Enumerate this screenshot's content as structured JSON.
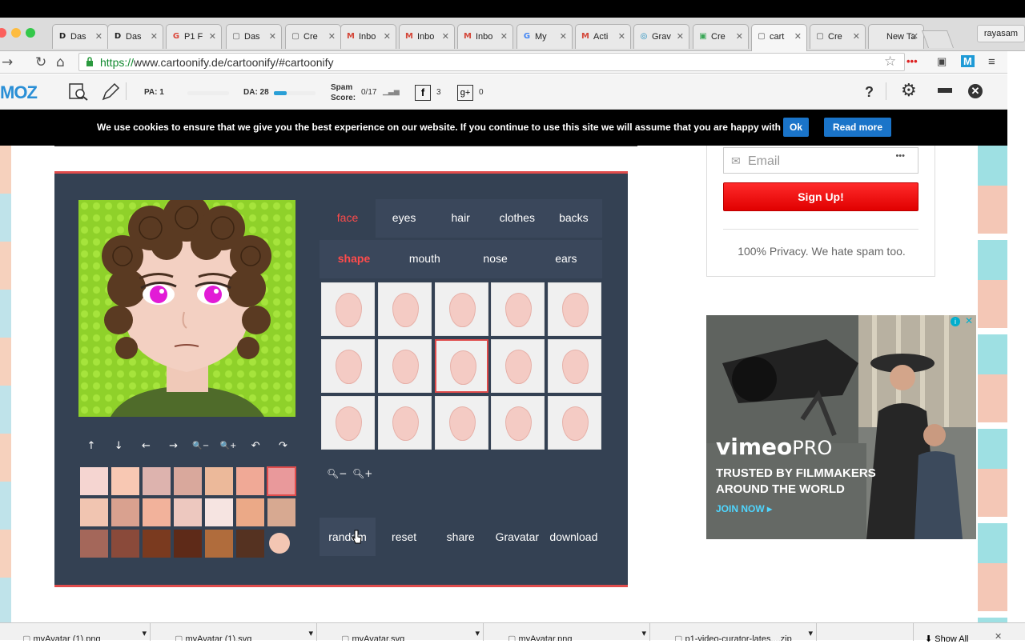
{
  "browser": {
    "tabs": [
      {
        "label": "Das",
        "fav": "D",
        "favcolor": "#222"
      },
      {
        "label": "Das",
        "fav": "D",
        "favcolor": "#222"
      },
      {
        "label": "P1 F",
        "fav": "G",
        "favcolor": "#db4437"
      },
      {
        "label": "Das",
        "fav": "▢",
        "favcolor": "#555"
      },
      {
        "label": "Cre",
        "fav": "▢",
        "favcolor": "#555"
      },
      {
        "label": "Inbo",
        "fav": "M",
        "favcolor": "#d44638"
      },
      {
        "label": "Inbo",
        "fav": "M",
        "favcolor": "#d44638"
      },
      {
        "label": "Inbo",
        "fav": "M",
        "favcolor": "#d44638"
      },
      {
        "label": "My",
        "fav": "G",
        "favcolor": "#4285f4"
      },
      {
        "label": "Acti",
        "fav": "M",
        "favcolor": "#d44638"
      },
      {
        "label": "Grav",
        "fav": "◎",
        "favcolor": "#1e8cbe"
      },
      {
        "label": "Cre",
        "fav": "▣",
        "favcolor": "#3aa757"
      },
      {
        "label": "cart",
        "fav": "▢",
        "favcolor": "#555"
      },
      {
        "label": "Cre",
        "fav": "▢",
        "favcolor": "#555"
      },
      {
        "label": "New Ta",
        "fav": "",
        "favcolor": "#555"
      }
    ],
    "profile": "rayasam",
    "url_scheme": "https://",
    "url_rest": "www.cartoonify.de/cartoonify/#cartoonify"
  },
  "moz": {
    "logo": "MOZ",
    "pa_label": "PA: 1",
    "da_label": "DA: 28",
    "da_fill": 0.3,
    "spam_label": "Spam",
    "spam_label2": "Score:",
    "spam_value": "0/17",
    "fb_count": "3",
    "gplus_count": "0",
    "help": "?"
  },
  "cookie": {
    "message": "We use cookies to ensure that we give you the best experience on our website. If you continue to use this site we will assume that you are happy with it.",
    "ok": "Ok",
    "read_more": "Read more"
  },
  "editor": {
    "main_tabs": [
      "face",
      "eyes",
      "hair",
      "clothes",
      "backs"
    ],
    "sub_tabs": [
      "shape",
      "mouth",
      "nose",
      "ears"
    ],
    "active_main": "face",
    "active_sub": "shape",
    "actions": [
      "random",
      "reset",
      "share",
      "Gravatar",
      "download"
    ],
    "controls": [
      "↑",
      "↓",
      "←",
      "→",
      "🔍−",
      "🔍+",
      "↶",
      "↷"
    ],
    "selected_shape": 8,
    "skin_colors": [
      [
        "#f5d5d1",
        "#f8c8b3",
        "#ddb3ae",
        "#d9a89c",
        "#ecb99a",
        "#f0a996",
        "#e9999b"
      ],
      [
        "#f1c5b1",
        "#d9a18f",
        "#f2b29b",
        "#edc8bf",
        "#f6e4e1",
        "#eba987",
        "#d7a991"
      ],
      [
        "#a4675a",
        "#8a4a3a",
        "#7a3a1f",
        "#5e2a18",
        "#b06c3c",
        "#553221"
      ]
    ],
    "selected_swatch": 6,
    "single_swatch_color": "#f3c6b3"
  },
  "sidebar": {
    "email_placeholder": "Email",
    "signup": "Sign Up!",
    "privacy": "100% Privacy. We hate spam too."
  },
  "ad": {
    "brand": "vimeo",
    "brand2": "PRO",
    "line1": "TRUSTED BY FILMMAKERS",
    "line2": "AROUND THE WORLD",
    "cta": "JOIN NOW ▸"
  },
  "downloads": {
    "items": [
      "myAvatar (1).png",
      "myAvatar (1).svg",
      "myAvatar.svg",
      "myAvatar.png",
      "p1-video-curator-lates....zip"
    ],
    "show_all": "Show All"
  }
}
